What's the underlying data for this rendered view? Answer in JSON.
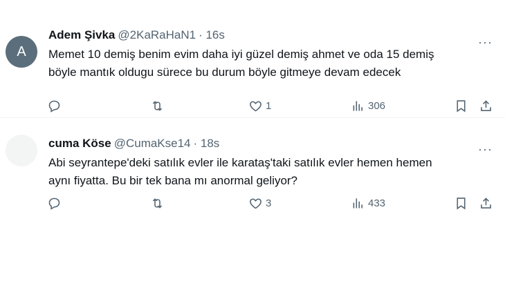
{
  "tweets": [
    {
      "avatar_letter": "A",
      "name": "Adem Şivka",
      "handle": "@2KaRaHaN1",
      "time": "· 16s",
      "text_line1": "Memet 10 demiş benim evim daha iyi güzel demiş ahmet  ve oda 15 demiş",
      "text_line2": "böyle mantık oldugu sürece bu durum böyle gitmeye devam edecek",
      "likes": "1",
      "views": "306"
    },
    {
      "avatar_letter": "",
      "name": "cuma Köse",
      "handle": "@CumaKse14",
      "time": "· 18s",
      "text_line1": "Abi seyrantepe'deki satılık evler ile karataş'taki satılık evler hemen hemen",
      "text_line2": "aynı fiyatta. Bu bir tek bana mı anormal geliyor?",
      "likes": "3",
      "views": "433"
    }
  ],
  "more_label": "···",
  "icons": {
    "reply": "reply-icon",
    "retweet": "retweet-icon",
    "like": "heart-icon",
    "views": "views-icon",
    "bookmark": "bookmark-icon",
    "share": "share-icon"
  },
  "colors": {
    "text": "#0f1419",
    "secondary": "#536471",
    "border": "#eff3f4",
    "avatar_a": "#5b6e7b"
  }
}
